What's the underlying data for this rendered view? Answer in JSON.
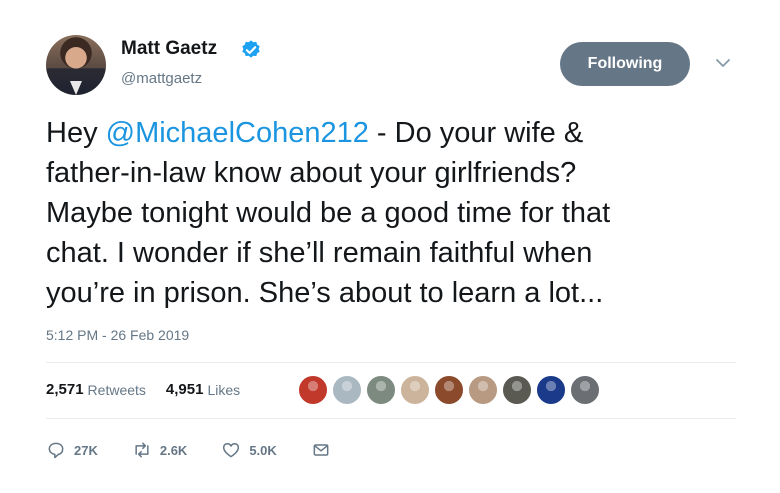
{
  "author": {
    "name": "Matt Gaetz",
    "handle": "@mattgaetz",
    "verified": true
  },
  "follow_button": {
    "label": "Following"
  },
  "tweet": {
    "text_prefix": "Hey ",
    "mention": "@MichaelCohen212",
    "text_rest": " - Do your wife &\nfather-in-law know about your girlfriends?\nMaybe tonight would be a good time for that\nchat. I wonder if she’ll remain faithful when\nyou’re in prison.  She’s about to learn a lot...",
    "timestamp": "5:12 PM - 26 Feb 2019"
  },
  "stats": {
    "retweets_count": "2,571",
    "retweets_label": "Retweets",
    "likes_count": "4,951",
    "likes_label": "Likes"
  },
  "liker_avatars": [
    {
      "icon": "lion-logo-avatar",
      "color": "#c0392b"
    },
    {
      "icon": "default-profile-avatar",
      "color": "#aab8c2"
    },
    {
      "icon": "profile-avatar",
      "color": "#7d8a80"
    },
    {
      "icon": "profile-avatar",
      "color": "#cbb49b"
    },
    {
      "icon": "profile-avatar",
      "color": "#8b4a2b"
    },
    {
      "icon": "profile-avatar",
      "color": "#b89a82"
    },
    {
      "icon": "profile-avatar",
      "color": "#5a5a52"
    },
    {
      "icon": "profile-avatar",
      "color": "#1b3a8a"
    },
    {
      "icon": "profile-avatar",
      "color": "#6b6e73"
    }
  ],
  "actions": {
    "reply_count": "27K",
    "retweet_count": "2.6K",
    "like_count": "5.0K"
  },
  "colors": {
    "link": "#1b95e0",
    "muted": "#657786",
    "verified": "#1da1f2",
    "following_button": "#657786"
  }
}
